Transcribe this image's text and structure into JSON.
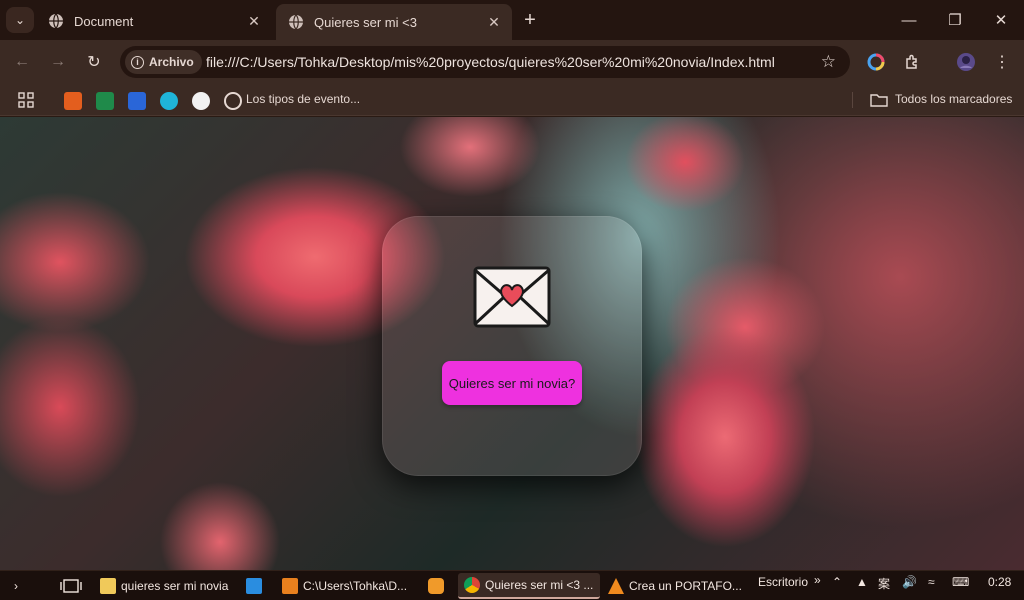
{
  "browser": {
    "tabs": [
      {
        "title": "Document",
        "active": false
      },
      {
        "title": "Quieres ser mi <3",
        "active": true
      }
    ],
    "address": {
      "chip_label": "Archivo",
      "url": "file:///C:/Users/Tohka/Desktop/mis%20proyectos/quieres%20ser%20mi%20novia/Index.html"
    },
    "bookmarks": {
      "items": [
        {
          "label": ""
        },
        {
          "label": ""
        },
        {
          "label": ""
        },
        {
          "label": ""
        },
        {
          "label": ""
        },
        {
          "label": "Los tipos de evento..."
        }
      ],
      "all_label": "Todos los marcadores"
    }
  },
  "page": {
    "envelope_icon": "envelope-heart-icon",
    "button_label": "Quieres ser mi novia?",
    "button_color": "#ee31df"
  },
  "taskbar": {
    "items": [
      {
        "label": "quieres ser mi novia",
        "icon": "folder-icon"
      },
      {
        "label": "",
        "icon": "vscode-icon"
      },
      {
        "label": "C:\\Users\\Tohka\\D...",
        "icon": "sublime-icon"
      },
      {
        "label": "",
        "icon": "app-icon"
      },
      {
        "label": "Quieres ser mi <3 ...",
        "icon": "chrome-icon"
      },
      {
        "label": "Crea un PORTAFO...",
        "icon": "vlc-icon"
      }
    ],
    "desktop_label": "Escritorio",
    "time": "0:28"
  }
}
